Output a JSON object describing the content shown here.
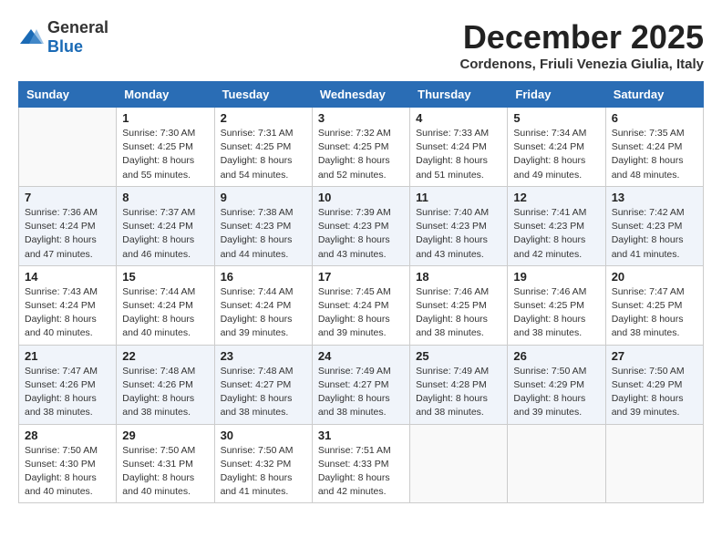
{
  "logo": {
    "general": "General",
    "blue": "Blue"
  },
  "title": {
    "month": "December 2025",
    "location": "Cordenons, Friuli Venezia Giulia, Italy"
  },
  "weekdays": [
    "Sunday",
    "Monday",
    "Tuesday",
    "Wednesday",
    "Thursday",
    "Friday",
    "Saturday"
  ],
  "weeks": [
    [
      {
        "day": "",
        "empty": true
      },
      {
        "day": "1",
        "sunrise": "Sunrise: 7:30 AM",
        "sunset": "Sunset: 4:25 PM",
        "daylight": "Daylight: 8 hours and 55 minutes."
      },
      {
        "day": "2",
        "sunrise": "Sunrise: 7:31 AM",
        "sunset": "Sunset: 4:25 PM",
        "daylight": "Daylight: 8 hours and 54 minutes."
      },
      {
        "day": "3",
        "sunrise": "Sunrise: 7:32 AM",
        "sunset": "Sunset: 4:25 PM",
        "daylight": "Daylight: 8 hours and 52 minutes."
      },
      {
        "day": "4",
        "sunrise": "Sunrise: 7:33 AM",
        "sunset": "Sunset: 4:24 PM",
        "daylight": "Daylight: 8 hours and 51 minutes."
      },
      {
        "day": "5",
        "sunrise": "Sunrise: 7:34 AM",
        "sunset": "Sunset: 4:24 PM",
        "daylight": "Daylight: 8 hours and 49 minutes."
      },
      {
        "day": "6",
        "sunrise": "Sunrise: 7:35 AM",
        "sunset": "Sunset: 4:24 PM",
        "daylight": "Daylight: 8 hours and 48 minutes."
      }
    ],
    [
      {
        "day": "7",
        "sunrise": "Sunrise: 7:36 AM",
        "sunset": "Sunset: 4:24 PM",
        "daylight": "Daylight: 8 hours and 47 minutes."
      },
      {
        "day": "8",
        "sunrise": "Sunrise: 7:37 AM",
        "sunset": "Sunset: 4:24 PM",
        "daylight": "Daylight: 8 hours and 46 minutes."
      },
      {
        "day": "9",
        "sunrise": "Sunrise: 7:38 AM",
        "sunset": "Sunset: 4:23 PM",
        "daylight": "Daylight: 8 hours and 44 minutes."
      },
      {
        "day": "10",
        "sunrise": "Sunrise: 7:39 AM",
        "sunset": "Sunset: 4:23 PM",
        "daylight": "Daylight: 8 hours and 43 minutes."
      },
      {
        "day": "11",
        "sunrise": "Sunrise: 7:40 AM",
        "sunset": "Sunset: 4:23 PM",
        "daylight": "Daylight: 8 hours and 43 minutes."
      },
      {
        "day": "12",
        "sunrise": "Sunrise: 7:41 AM",
        "sunset": "Sunset: 4:23 PM",
        "daylight": "Daylight: 8 hours and 42 minutes."
      },
      {
        "day": "13",
        "sunrise": "Sunrise: 7:42 AM",
        "sunset": "Sunset: 4:23 PM",
        "daylight": "Daylight: 8 hours and 41 minutes."
      }
    ],
    [
      {
        "day": "14",
        "sunrise": "Sunrise: 7:43 AM",
        "sunset": "Sunset: 4:24 PM",
        "daylight": "Daylight: 8 hours and 40 minutes."
      },
      {
        "day": "15",
        "sunrise": "Sunrise: 7:44 AM",
        "sunset": "Sunset: 4:24 PM",
        "daylight": "Daylight: 8 hours and 40 minutes."
      },
      {
        "day": "16",
        "sunrise": "Sunrise: 7:44 AM",
        "sunset": "Sunset: 4:24 PM",
        "daylight": "Daylight: 8 hours and 39 minutes."
      },
      {
        "day": "17",
        "sunrise": "Sunrise: 7:45 AM",
        "sunset": "Sunset: 4:24 PM",
        "daylight": "Daylight: 8 hours and 39 minutes."
      },
      {
        "day": "18",
        "sunrise": "Sunrise: 7:46 AM",
        "sunset": "Sunset: 4:25 PM",
        "daylight": "Daylight: 8 hours and 38 minutes."
      },
      {
        "day": "19",
        "sunrise": "Sunrise: 7:46 AM",
        "sunset": "Sunset: 4:25 PM",
        "daylight": "Daylight: 8 hours and 38 minutes."
      },
      {
        "day": "20",
        "sunrise": "Sunrise: 7:47 AM",
        "sunset": "Sunset: 4:25 PM",
        "daylight": "Daylight: 8 hours and 38 minutes."
      }
    ],
    [
      {
        "day": "21",
        "sunrise": "Sunrise: 7:47 AM",
        "sunset": "Sunset: 4:26 PM",
        "daylight": "Daylight: 8 hours and 38 minutes."
      },
      {
        "day": "22",
        "sunrise": "Sunrise: 7:48 AM",
        "sunset": "Sunset: 4:26 PM",
        "daylight": "Daylight: 8 hours and 38 minutes."
      },
      {
        "day": "23",
        "sunrise": "Sunrise: 7:48 AM",
        "sunset": "Sunset: 4:27 PM",
        "daylight": "Daylight: 8 hours and 38 minutes."
      },
      {
        "day": "24",
        "sunrise": "Sunrise: 7:49 AM",
        "sunset": "Sunset: 4:27 PM",
        "daylight": "Daylight: 8 hours and 38 minutes."
      },
      {
        "day": "25",
        "sunrise": "Sunrise: 7:49 AM",
        "sunset": "Sunset: 4:28 PM",
        "daylight": "Daylight: 8 hours and 38 minutes."
      },
      {
        "day": "26",
        "sunrise": "Sunrise: 7:50 AM",
        "sunset": "Sunset: 4:29 PM",
        "daylight": "Daylight: 8 hours and 39 minutes."
      },
      {
        "day": "27",
        "sunrise": "Sunrise: 7:50 AM",
        "sunset": "Sunset: 4:29 PM",
        "daylight": "Daylight: 8 hours and 39 minutes."
      }
    ],
    [
      {
        "day": "28",
        "sunrise": "Sunrise: 7:50 AM",
        "sunset": "Sunset: 4:30 PM",
        "daylight": "Daylight: 8 hours and 40 minutes."
      },
      {
        "day": "29",
        "sunrise": "Sunrise: 7:50 AM",
        "sunset": "Sunset: 4:31 PM",
        "daylight": "Daylight: 8 hours and 40 minutes."
      },
      {
        "day": "30",
        "sunrise": "Sunrise: 7:50 AM",
        "sunset": "Sunset: 4:32 PM",
        "daylight": "Daylight: 8 hours and 41 minutes."
      },
      {
        "day": "31",
        "sunrise": "Sunrise: 7:51 AM",
        "sunset": "Sunset: 4:33 PM",
        "daylight": "Daylight: 8 hours and 42 minutes."
      },
      {
        "day": "",
        "empty": true
      },
      {
        "day": "",
        "empty": true
      },
      {
        "day": "",
        "empty": true
      }
    ]
  ]
}
